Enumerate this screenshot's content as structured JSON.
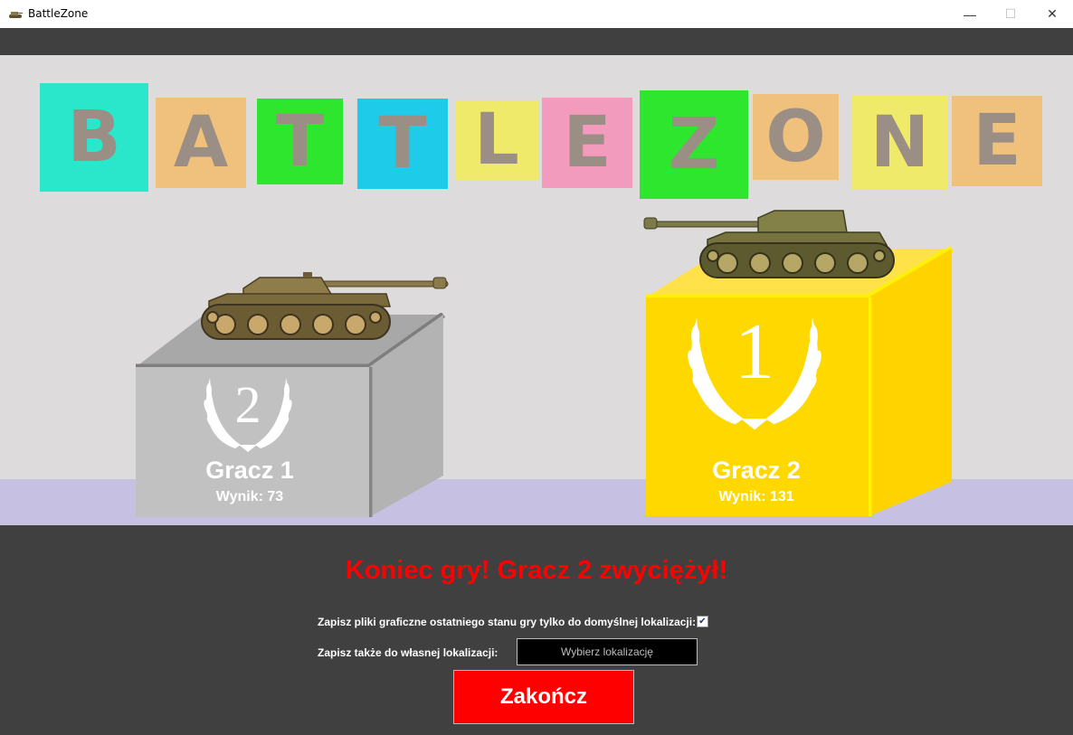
{
  "window": {
    "title": "BattleZone",
    "icon": "tank-icon",
    "minimize_glyph": "—",
    "maximize_glyph": "☐",
    "close_glyph": "✕"
  },
  "logo": {
    "letters": [
      {
        "char": "B",
        "color": "#2ae6cb"
      },
      {
        "char": "A",
        "color": "#f0c07d"
      },
      {
        "char": "T",
        "color": "#2fe62f"
      },
      {
        "char": "T",
        "color": "#1ecbe8"
      },
      {
        "char": "L",
        "color": "#f0ea6a"
      },
      {
        "char": "E",
        "color": "#f39bbc"
      },
      {
        "char": "Z",
        "color": "#2fe62f"
      },
      {
        "char": "O",
        "color": "#f0c07d"
      },
      {
        "char": "N",
        "color": "#f0ea6a"
      },
      {
        "char": "E",
        "color": "#f0c07d"
      }
    ]
  },
  "podiums": {
    "second": {
      "rank": "2",
      "player": "Gracz 1",
      "score": "Wynik: 73",
      "color": "#c1c1c1"
    },
    "first": {
      "rank": "1",
      "player": "Gracz 2",
      "score": "Wynik: 131",
      "color": "#ffd800"
    }
  },
  "result_message": "Koniec gry! Gracz 2 zwyciężył!",
  "options": {
    "save_default_label": "Zapisz pliki graficzne ostatniego stanu gry tylko do domyślnej lokalizacji:",
    "save_default_checked": true,
    "check_glyph": "✔",
    "save_custom_label": "Zapisz także do własnej lokalizacji:",
    "choose_location_button": "Wybierz lokalizację"
  },
  "end_button": "Zakończ"
}
